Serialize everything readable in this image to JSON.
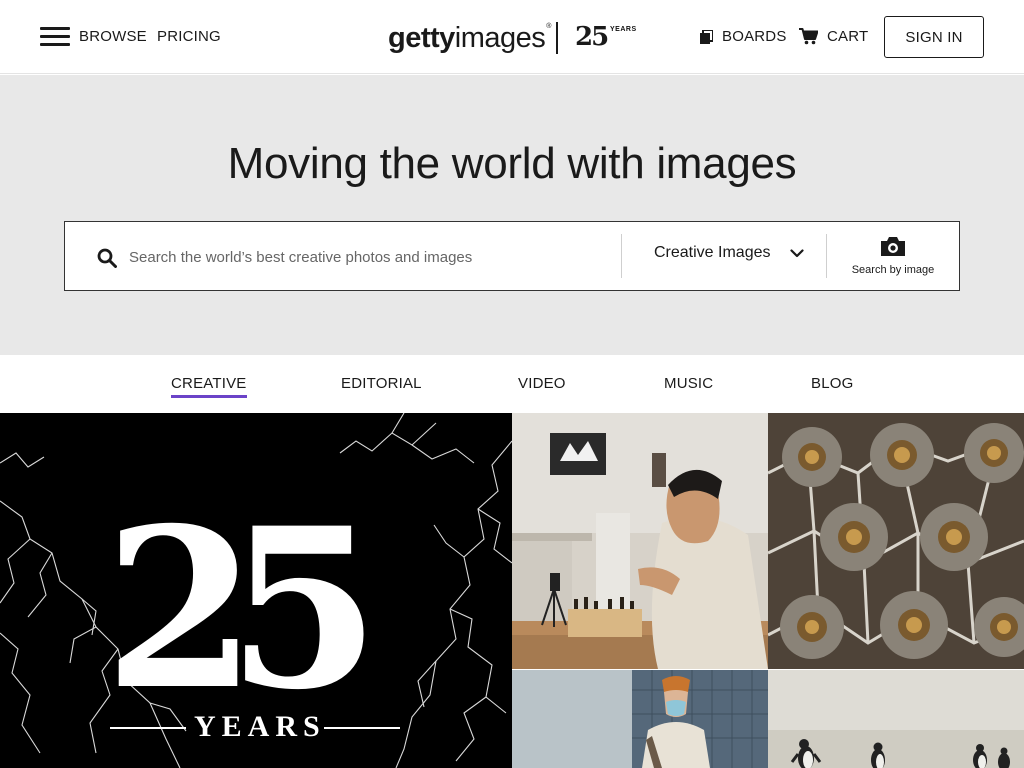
{
  "header": {
    "menu_icon": "hamburger-menu-icon",
    "browse_label": "BROWSE",
    "pricing_label": "PRICING",
    "logo": {
      "getty": "getty",
      "images": "images",
      "registered": "®",
      "anniversary_number": "25",
      "anniversary_word": "YEARS"
    },
    "boards_label": "BOARDS",
    "boards_icon": "boards-icon",
    "cart_label": "CART",
    "cart_icon": "cart-icon",
    "signin_label": "SIGN IN"
  },
  "hero": {
    "title": "Moving the world with images",
    "background_color": "#e8e8e8",
    "search": {
      "placeholder": "Search the world’s best creative photos and images",
      "value": "",
      "search_icon": "search-icon",
      "category_selected": "Creative Images",
      "category_icon": "chevron-down-icon",
      "search_by_image_label": "Search by image",
      "search_by_image_icon": "camera-icon"
    }
  },
  "tabs": {
    "active_color": "#6b43c8",
    "items": [
      {
        "label": "CREATIVE",
        "active": true
      },
      {
        "label": "EDITORIAL",
        "active": false
      },
      {
        "label": "VIDEO",
        "active": false
      },
      {
        "label": "MUSIC",
        "active": false
      },
      {
        "label": "BLOG",
        "active": false
      }
    ]
  },
  "gallery": {
    "feature": {
      "number": "25",
      "word": "YEARS",
      "background_color": "#000000"
    },
    "tiles": [
      {
        "subject": "man playing chess in kitchen"
      },
      {
        "subject": "sea urchin close-up pattern"
      },
      {
        "subject": "woman with face mask and orange beanie"
      },
      {
        "subject": "penguins on beach"
      }
    ]
  }
}
